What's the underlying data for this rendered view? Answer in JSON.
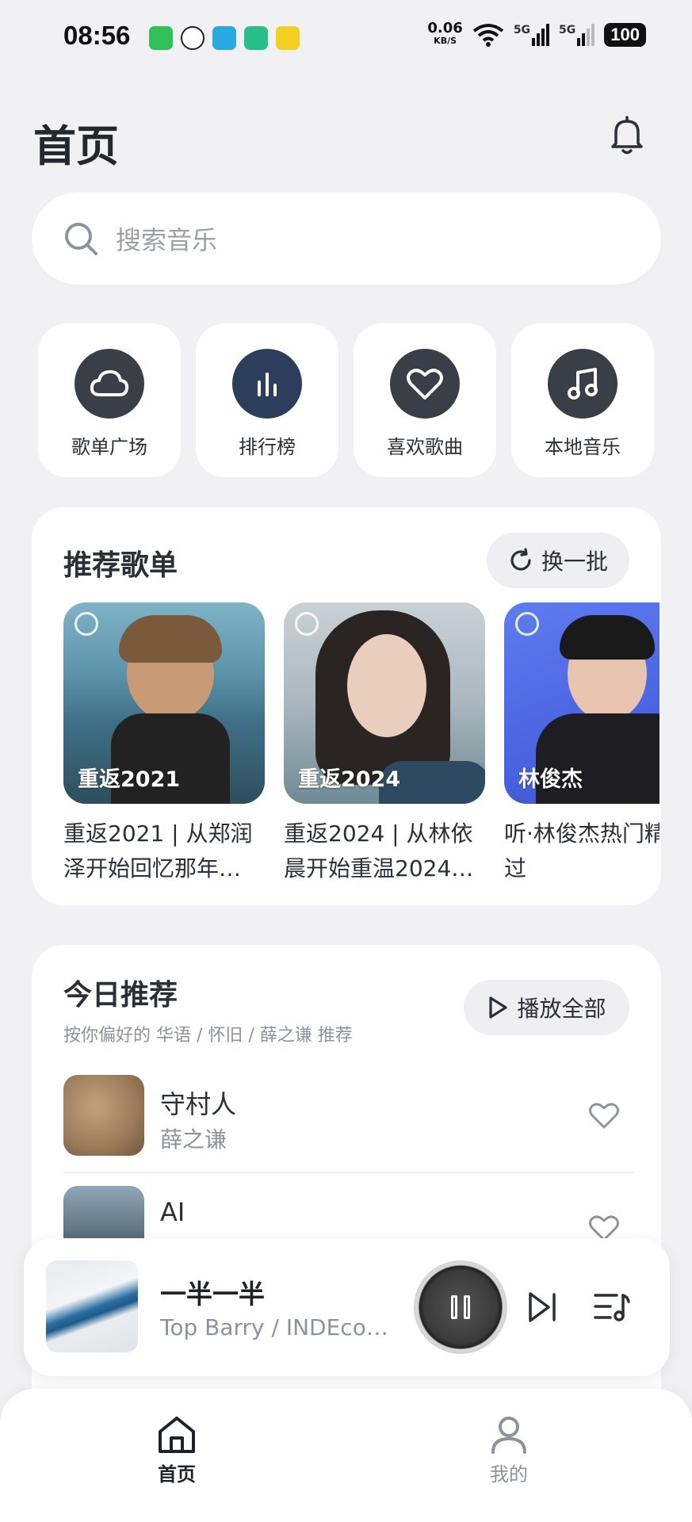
{
  "status_bar": {
    "time": "08:56",
    "net_speed": "0.06",
    "net_unit": "KB/S",
    "signal1": "5G",
    "signal2": "5G",
    "battery": "100",
    "app_icon_colors": [
      "#2fc25b",
      "#222222",
      "#2aa8e0",
      "#27c08a",
      "#f5cf1f"
    ]
  },
  "header": {
    "title": "首页"
  },
  "search": {
    "placeholder": "搜索音乐"
  },
  "quick_entries": [
    {
      "label": "歌单广场",
      "icon": "cloud-icon"
    },
    {
      "label": "排行榜",
      "icon": "bar-chart-icon"
    },
    {
      "label": "喜欢歌曲",
      "icon": "heart-icon"
    },
    {
      "label": "本地音乐",
      "icon": "music-note-icon"
    }
  ],
  "recommend_playlists": {
    "title": "推荐歌单",
    "refresh_label": "换一批",
    "items": [
      {
        "tag": "重返2021",
        "name": "重返2021 | 从郑润泽开始回忆那年…"
      },
      {
        "tag": "重返2024",
        "name": "重返2024 | 从林依晨开始重温2024…"
      },
      {
        "tag": "林俊杰",
        "name": "听·林俊杰热门精选过"
      }
    ]
  },
  "today": {
    "title": "今日推荐",
    "subtitle": "按你偏好的 华语 / 怀旧 / 薛之谦 推荐",
    "play_all_label": "播放全部",
    "songs": [
      {
        "title": "守村人",
        "artist": "薛之谦"
      },
      {
        "title": "AI",
        "artist": ""
      }
    ]
  },
  "player": {
    "title": "一半一半",
    "artist": "Top Barry / INDEcom..."
  },
  "bottom_nav": [
    {
      "label": "首页",
      "active": true
    },
    {
      "label": "我的",
      "active": false
    }
  ],
  "colors": {
    "accent": "#3a3e47",
    "background": "#f1f1f3"
  }
}
